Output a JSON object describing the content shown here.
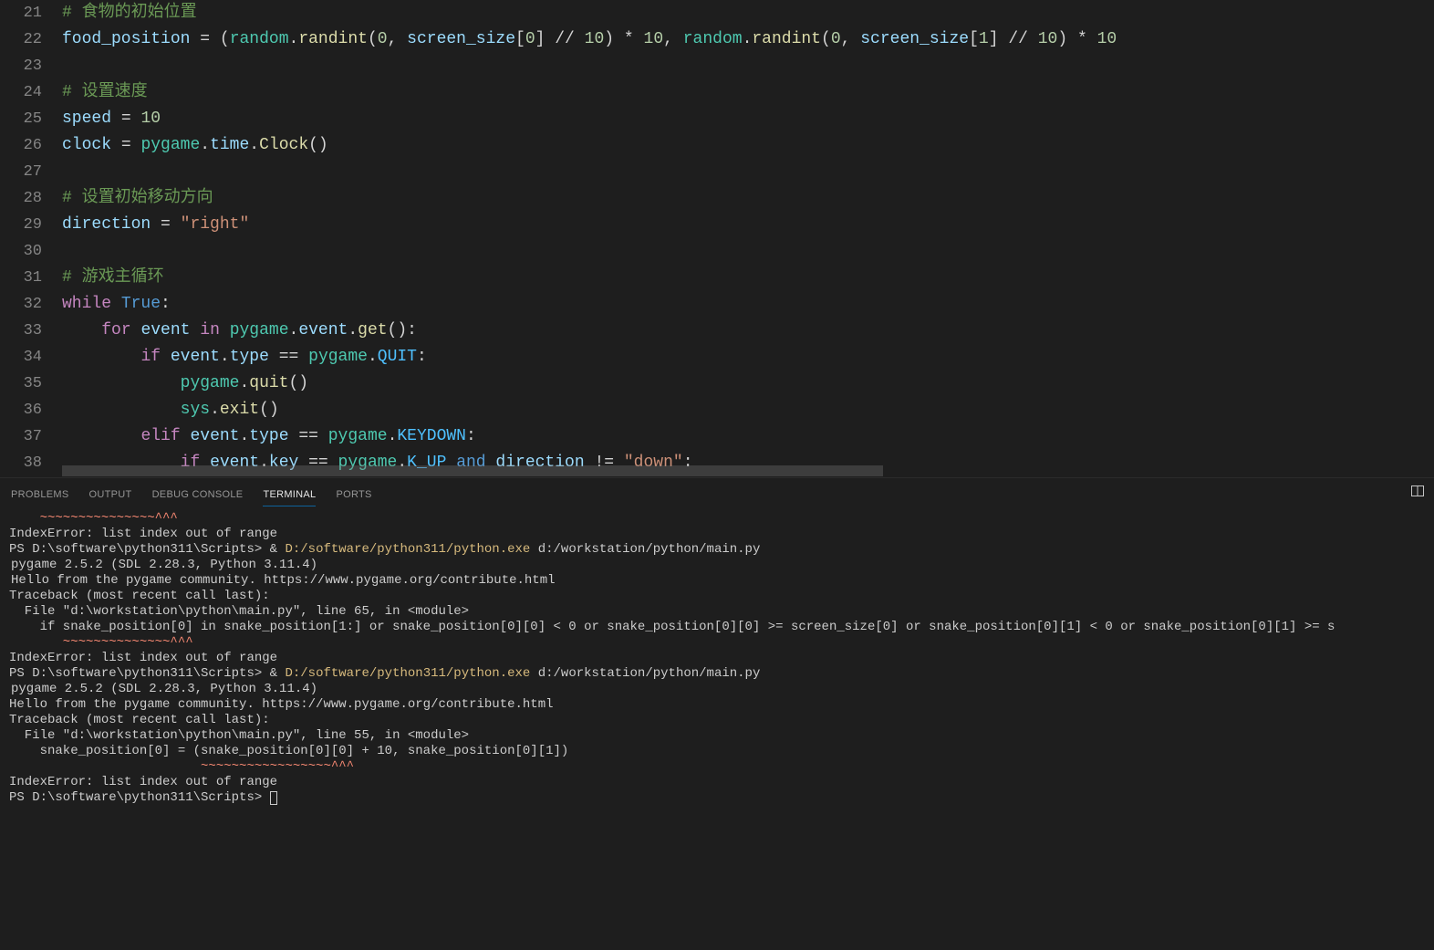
{
  "editor": {
    "lines": [
      {
        "n": 21,
        "indent": 0,
        "tokens": [
          [
            "comment",
            "# 食物的初始位置"
          ]
        ]
      },
      {
        "n": 22,
        "indent": 0,
        "tokens": [
          [
            "variable",
            "food_position"
          ],
          [
            "operator",
            " "
          ],
          [
            "operator",
            "="
          ],
          [
            "operator",
            " "
          ],
          [
            "paren",
            "("
          ],
          [
            "module",
            "random"
          ],
          [
            "operator",
            "."
          ],
          [
            "func",
            "randint"
          ],
          [
            "paren",
            "("
          ],
          [
            "number",
            "0"
          ],
          [
            "operator",
            ", "
          ],
          [
            "variable",
            "screen_size"
          ],
          [
            "paren",
            "["
          ],
          [
            "number",
            "0"
          ],
          [
            "paren",
            "]"
          ],
          [
            "operator",
            " "
          ],
          [
            "operator",
            "//"
          ],
          [
            "operator",
            " "
          ],
          [
            "number",
            "10"
          ],
          [
            "paren",
            ")"
          ],
          [
            "operator",
            " "
          ],
          [
            "operator",
            "*"
          ],
          [
            "operator",
            " "
          ],
          [
            "number",
            "10"
          ],
          [
            "operator",
            ", "
          ],
          [
            "module",
            "random"
          ],
          [
            "operator",
            "."
          ],
          [
            "func",
            "randint"
          ],
          [
            "paren",
            "("
          ],
          [
            "number",
            "0"
          ],
          [
            "operator",
            ", "
          ],
          [
            "variable",
            "screen_size"
          ],
          [
            "paren",
            "["
          ],
          [
            "number",
            "1"
          ],
          [
            "paren",
            "]"
          ],
          [
            "operator",
            " "
          ],
          [
            "operator",
            "//"
          ],
          [
            "operator",
            " "
          ],
          [
            "number",
            "10"
          ],
          [
            "paren",
            ")"
          ],
          [
            "operator",
            " "
          ],
          [
            "operator",
            "*"
          ],
          [
            "operator",
            " "
          ],
          [
            "number",
            "10"
          ]
        ]
      },
      {
        "n": 23,
        "indent": 0,
        "tokens": []
      },
      {
        "n": 24,
        "indent": 0,
        "tokens": [
          [
            "comment",
            "# 设置速度"
          ]
        ]
      },
      {
        "n": 25,
        "indent": 0,
        "tokens": [
          [
            "variable",
            "speed"
          ],
          [
            "operator",
            " "
          ],
          [
            "operator",
            "="
          ],
          [
            "operator",
            " "
          ],
          [
            "number",
            "10"
          ]
        ]
      },
      {
        "n": 26,
        "indent": 0,
        "tokens": [
          [
            "variable",
            "clock"
          ],
          [
            "operator",
            " "
          ],
          [
            "operator",
            "="
          ],
          [
            "operator",
            " "
          ],
          [
            "module",
            "pygame"
          ],
          [
            "operator",
            "."
          ],
          [
            "variable",
            "time"
          ],
          [
            "operator",
            "."
          ],
          [
            "func",
            "Clock"
          ],
          [
            "paren",
            "()"
          ]
        ]
      },
      {
        "n": 27,
        "indent": 0,
        "tokens": []
      },
      {
        "n": 28,
        "indent": 0,
        "tokens": [
          [
            "comment",
            "# 设置初始移动方向"
          ]
        ]
      },
      {
        "n": 29,
        "indent": 0,
        "tokens": [
          [
            "variable",
            "direction"
          ],
          [
            "operator",
            " "
          ],
          [
            "operator",
            "="
          ],
          [
            "operator",
            " "
          ],
          [
            "string",
            "\"right\""
          ]
        ]
      },
      {
        "n": 30,
        "indent": 0,
        "tokens": []
      },
      {
        "n": 31,
        "indent": 0,
        "tokens": [
          [
            "comment",
            "# 游戏主循环"
          ]
        ]
      },
      {
        "n": 32,
        "indent": 0,
        "tokens": [
          [
            "keyword",
            "while"
          ],
          [
            "operator",
            " "
          ],
          [
            "const",
            "True"
          ],
          [
            "operator",
            ":"
          ]
        ]
      },
      {
        "n": 33,
        "indent": 1,
        "tokens": [
          [
            "keyword",
            "for"
          ],
          [
            "operator",
            " "
          ],
          [
            "variable",
            "event"
          ],
          [
            "operator",
            " "
          ],
          [
            "keyword",
            "in"
          ],
          [
            "operator",
            " "
          ],
          [
            "module",
            "pygame"
          ],
          [
            "operator",
            "."
          ],
          [
            "variable",
            "event"
          ],
          [
            "operator",
            "."
          ],
          [
            "func",
            "get"
          ],
          [
            "paren",
            "()"
          ],
          [
            "operator",
            ":"
          ]
        ]
      },
      {
        "n": 34,
        "indent": 2,
        "tokens": [
          [
            "keyword",
            "if"
          ],
          [
            "operator",
            " "
          ],
          [
            "variable",
            "event"
          ],
          [
            "operator",
            "."
          ],
          [
            "variable",
            "type"
          ],
          [
            "operator",
            " "
          ],
          [
            "operator",
            "=="
          ],
          [
            "operator",
            " "
          ],
          [
            "module",
            "pygame"
          ],
          [
            "operator",
            "."
          ],
          [
            "constcaps",
            "QUIT"
          ],
          [
            "operator",
            ":"
          ]
        ]
      },
      {
        "n": 35,
        "indent": 3,
        "tokens": [
          [
            "module",
            "pygame"
          ],
          [
            "operator",
            "."
          ],
          [
            "func",
            "quit"
          ],
          [
            "paren",
            "()"
          ]
        ]
      },
      {
        "n": 36,
        "indent": 3,
        "tokens": [
          [
            "module",
            "sys"
          ],
          [
            "operator",
            "."
          ],
          [
            "func",
            "exit"
          ],
          [
            "paren",
            "()"
          ]
        ]
      },
      {
        "n": 37,
        "indent": 2,
        "tokens": [
          [
            "keyword",
            "elif"
          ],
          [
            "operator",
            " "
          ],
          [
            "variable",
            "event"
          ],
          [
            "operator",
            "."
          ],
          [
            "variable",
            "type"
          ],
          [
            "operator",
            " "
          ],
          [
            "operator",
            "=="
          ],
          [
            "operator",
            " "
          ],
          [
            "module",
            "pygame"
          ],
          [
            "operator",
            "."
          ],
          [
            "constcaps",
            "KEYDOWN"
          ],
          [
            "operator",
            ":"
          ]
        ]
      },
      {
        "n": 38,
        "indent": 3,
        "tokens": [
          [
            "keyword",
            "if"
          ],
          [
            "operator",
            " "
          ],
          [
            "variable",
            "event"
          ],
          [
            "operator",
            "."
          ],
          [
            "variable",
            "key"
          ],
          [
            "operator",
            " "
          ],
          [
            "operator",
            "=="
          ],
          [
            "operator",
            " "
          ],
          [
            "module",
            "pygame"
          ],
          [
            "operator",
            "."
          ],
          [
            "constcaps",
            "K_UP"
          ],
          [
            "operator",
            " "
          ],
          [
            "kwblue",
            "and"
          ],
          [
            "operator",
            " "
          ],
          [
            "variable",
            "direction"
          ],
          [
            "operator",
            " "
          ],
          [
            "operator",
            "!="
          ],
          [
            "operator",
            " "
          ],
          [
            "string",
            "\"down\""
          ],
          [
            "operator",
            ":"
          ]
        ]
      }
    ]
  },
  "panel": {
    "tabs": {
      "problems": "Problems",
      "output": "Output",
      "debug_console": "Debug Console",
      "terminal": "Terminal",
      "ports": "Ports"
    }
  },
  "terminal": {
    "lines": [
      {
        "type": "squiggle",
        "text": "    ~~~~~~~~~~~~~~~^^^"
      },
      {
        "type": "plain",
        "text": "IndexError: list index out of range"
      },
      {
        "type": "ps",
        "prompt": "PS D:\\software\\python311\\Scripts> ",
        "amp": "& ",
        "exe": "D:/software/python311/python.exe",
        "arg": " d:/workstation/python/main.py"
      },
      {
        "type": "err",
        "text": "pygame 2.5.2 (SDL 2.28.3, Python 3.11.4)"
      },
      {
        "type": "err",
        "text": "Hello from the pygame community. https://www.pygame.org/contribute.html"
      },
      {
        "type": "plain",
        "text": "Traceback (most recent call last):"
      },
      {
        "type": "plain",
        "text": "  File \"d:\\workstation\\python\\main.py\", line 65, in <module>"
      },
      {
        "type": "plain",
        "text": "    if snake_position[0] in snake_position[1:] or snake_position[0][0] < 0 or snake_position[0][0] >= screen_size[0] or snake_position[0][1] < 0 or snake_position[0][1] >= s"
      },
      {
        "type": "squiggle",
        "text": "       ~~~~~~~~~~~~~~^^^"
      },
      {
        "type": "plain",
        "text": "IndexError: list index out of range"
      },
      {
        "type": "ps",
        "prompt": "PS D:\\software\\python311\\Scripts> ",
        "amp": "& ",
        "exe": "D:/software/python311/python.exe",
        "arg": " d:/workstation/python/main.py"
      },
      {
        "type": "err",
        "text": "pygame 2.5.2 (SDL 2.28.3, Python 3.11.4)"
      },
      {
        "type": "plain",
        "text": "Hello from the pygame community. https://www.pygame.org/contribute.html"
      },
      {
        "type": "plain",
        "text": "Traceback (most recent call last):"
      },
      {
        "type": "plain",
        "text": "  File \"d:\\workstation\\python\\main.py\", line 55, in <module>"
      },
      {
        "type": "plain",
        "text": "    snake_position[0] = (snake_position[0][0] + 10, snake_position[0][1])"
      },
      {
        "type": "squiggle",
        "text": "                         ~~~~~~~~~~~~~~~~~^^^"
      },
      {
        "type": "plain",
        "text": "IndexError: list index out of range"
      },
      {
        "type": "pscursor",
        "prompt": "PS D:\\software\\python311\\Scripts> "
      }
    ]
  }
}
